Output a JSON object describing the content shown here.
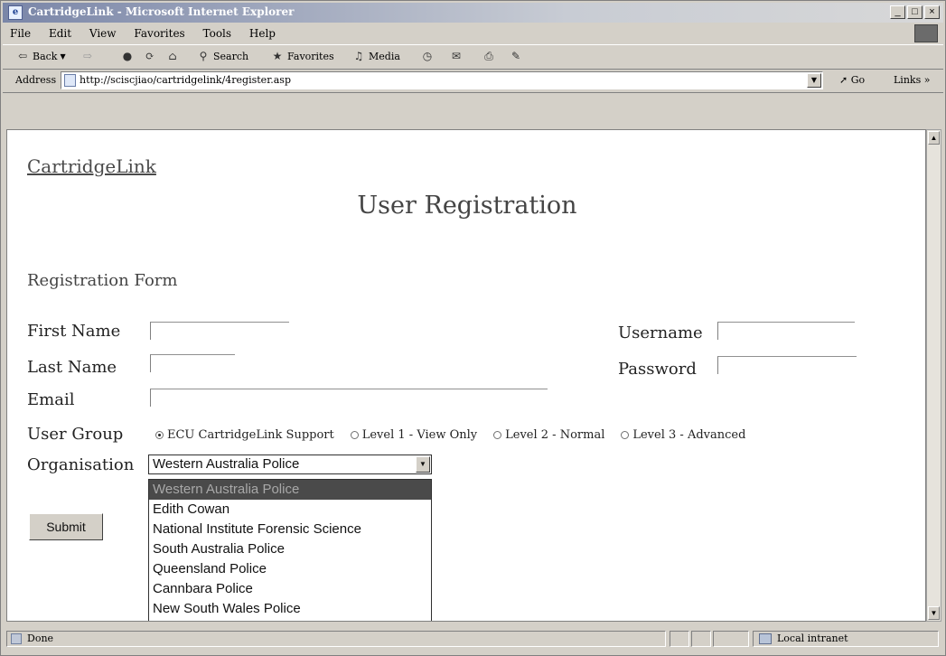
{
  "window": {
    "title": "CartridgeLink - Microsoft Internet Explorer",
    "min_glyph": "_",
    "max_glyph": "□",
    "close_glyph": "×"
  },
  "menu": [
    "File",
    "Edit",
    "View",
    "Favorites",
    "Tools",
    "Help"
  ],
  "toolbar": {
    "back": "Back",
    "search": "Search",
    "favorites": "Favorites",
    "media": "Media"
  },
  "address": {
    "label": "Address",
    "url": "http://sciscjiao/cartridgelink/4register.asp",
    "go": "Go",
    "links": "Links »"
  },
  "page": {
    "brand": "CartridgeLink",
    "heading": "User Registration",
    "form_title": "Registration Form",
    "labels": {
      "first_name": "First Name",
      "last_name": "Last Name",
      "email": "Email",
      "user_group": "User Group",
      "organisation": "Organisation",
      "username": "Username",
      "password": "Password"
    },
    "user_groups": [
      {
        "label": "ECU CartridgeLink Support",
        "selected": true
      },
      {
        "label": "Level 1 - View Only",
        "selected": false
      },
      {
        "label": "Level 2 - Normal",
        "selected": false
      },
      {
        "label": "Level 3 - Advanced",
        "selected": false
      }
    ],
    "organisation_selected": "Western Australia Police",
    "organisation_options": [
      "Western Australia Police",
      "Edith Cowan",
      "National Institute Forensic Science",
      "South Australia Police",
      "Queensland Police",
      "Cannbara Police",
      "New South Wales Police"
    ],
    "submit": "Submit"
  },
  "status": {
    "text": "Done",
    "zone": "Local intranet"
  }
}
